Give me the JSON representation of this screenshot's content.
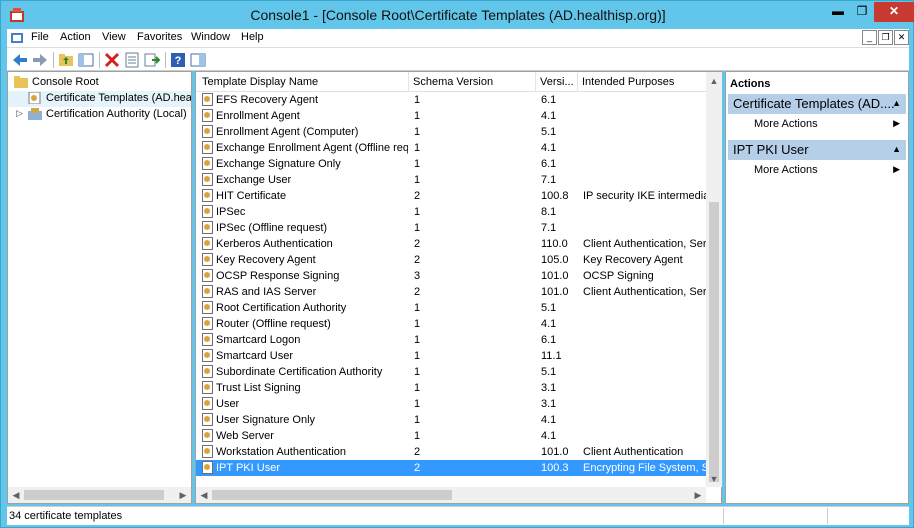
{
  "window": {
    "title": "Console1 - [Console Root\\Certificate Templates (AD.healthisp.org)]",
    "minimize": "▬",
    "maximize": "❐",
    "close": "✕"
  },
  "menu": {
    "items": [
      "File",
      "Action",
      "View",
      "Favorites",
      "Window",
      "Help"
    ],
    "mdi_minimize": "_",
    "mdi_restore": "❐",
    "mdi_close": "✕"
  },
  "toolbar": {
    "icons": [
      "back-icon",
      "forward-icon",
      "up-folder-icon",
      "show-hide-tree-icon",
      "delete-icon",
      "properties-icon",
      "export-list-icon",
      "help-icon",
      "show-hide-action-pane-icon"
    ]
  },
  "tree": {
    "items": [
      {
        "label": "Console Root",
        "expander": ""
      },
      {
        "label": "Certificate Templates (AD.healthisp.org)",
        "expander": ""
      },
      {
        "label": "Certification Authority (Local)",
        "expander": "▷"
      }
    ]
  },
  "list": {
    "columns": [
      "Template Display Name",
      "Schema Version",
      "Versi...",
      "Intended Purposes"
    ],
    "rows": [
      {
        "name": "EFS Recovery Agent",
        "schema": "1",
        "version": "6.1",
        "purposes": ""
      },
      {
        "name": "Enrollment Agent",
        "schema": "1",
        "version": "4.1",
        "purposes": ""
      },
      {
        "name": "Enrollment Agent (Computer)",
        "schema": "1",
        "version": "5.1",
        "purposes": ""
      },
      {
        "name": "Exchange Enrollment Agent (Offline requ...",
        "schema": "1",
        "version": "4.1",
        "purposes": ""
      },
      {
        "name": "Exchange Signature Only",
        "schema": "1",
        "version": "6.1",
        "purposes": ""
      },
      {
        "name": "Exchange User",
        "schema": "1",
        "version": "7.1",
        "purposes": ""
      },
      {
        "name": "HIT Certificate",
        "schema": "2",
        "version": "100.8",
        "purposes": "IP security IKE intermediate,"
      },
      {
        "name": "IPSec",
        "schema": "1",
        "version": "8.1",
        "purposes": ""
      },
      {
        "name": "IPSec (Offline request)",
        "schema": "1",
        "version": "7.1",
        "purposes": ""
      },
      {
        "name": "Kerberos Authentication",
        "schema": "2",
        "version": "110.0",
        "purposes": "Client Authentication, Serve"
      },
      {
        "name": "Key Recovery Agent",
        "schema": "2",
        "version": "105.0",
        "purposes": "Key Recovery Agent"
      },
      {
        "name": "OCSP Response Signing",
        "schema": "3",
        "version": "101.0",
        "purposes": "OCSP Signing"
      },
      {
        "name": "RAS and IAS Server",
        "schema": "2",
        "version": "101.0",
        "purposes": "Client Authentication, Serve"
      },
      {
        "name": "Root Certification Authority",
        "schema": "1",
        "version": "5.1",
        "purposes": ""
      },
      {
        "name": "Router (Offline request)",
        "schema": "1",
        "version": "4.1",
        "purposes": ""
      },
      {
        "name": "Smartcard Logon",
        "schema": "1",
        "version": "6.1",
        "purposes": ""
      },
      {
        "name": "Smartcard User",
        "schema": "1",
        "version": "11.1",
        "purposes": ""
      },
      {
        "name": "Subordinate Certification Authority",
        "schema": "1",
        "version": "5.1",
        "purposes": ""
      },
      {
        "name": "Trust List Signing",
        "schema": "1",
        "version": "3.1",
        "purposes": ""
      },
      {
        "name": "User",
        "schema": "1",
        "version": "3.1",
        "purposes": ""
      },
      {
        "name": "User Signature Only",
        "schema": "1",
        "version": "4.1",
        "purposes": ""
      },
      {
        "name": "Web Server",
        "schema": "1",
        "version": "4.1",
        "purposes": ""
      },
      {
        "name": "Workstation Authentication",
        "schema": "2",
        "version": "101.0",
        "purposes": "Client Authentication"
      },
      {
        "name": "IPT PKI User",
        "schema": "2",
        "version": "100.3",
        "purposes": "Encrypting File System, Secu"
      }
    ],
    "selected_index": 23
  },
  "actions": {
    "title": "Actions",
    "sections": [
      {
        "header": "Certificate Templates (AD....",
        "items": [
          "More Actions"
        ]
      },
      {
        "header": "IPT PKI User",
        "items": [
          "More Actions"
        ]
      }
    ]
  },
  "status": {
    "text": "34 certificate templates"
  },
  "colors": {
    "selection": "#3399ff",
    "window_frame": "#62c6ea",
    "action_header": "#b6cfe9",
    "close_button": "#c73a32"
  }
}
